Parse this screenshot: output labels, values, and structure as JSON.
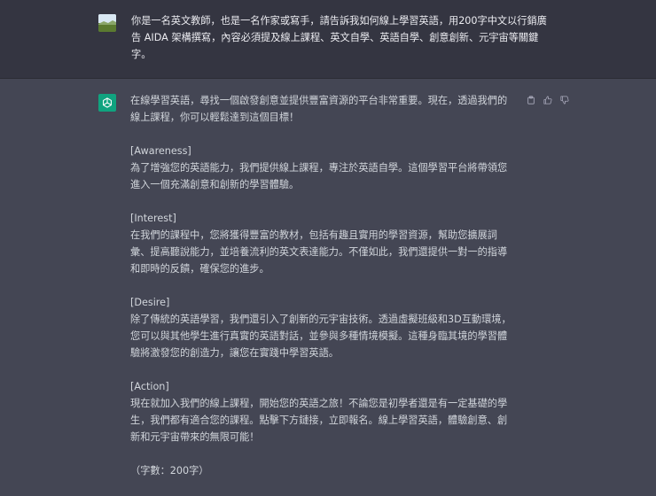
{
  "user_message": {
    "text": "你是一名英文教師，也是一名作家或寫手，請告訴我如何線上學習英語，用200字中文以行銷廣告 AIDA 架構撰寫，內容必須提及線上課程、英文自學、英語自學、創意創新、元宇宙等關鍵字。"
  },
  "assistant_message": {
    "intro": "在線學習英語，尋找一個啟發創意並提供豐富資源的平台非常重要。現在，透過我們的線上課程，你可以輕鬆達到這個目標！",
    "sections": [
      {
        "heading": "[Awareness]",
        "body": "為了增強您的英語能力，我們提供線上課程，專注於英語自學。這個學習平台將帶領您進入一個充滿創意和創新的學習體驗。"
      },
      {
        "heading": "[Interest]",
        "body": "在我們的課程中，您將獲得豐富的教材，包括有趣且實用的學習資源，幫助您擴展詞彙、提高聽說能力，並培養流利的英文表達能力。不僅如此，我們還提供一對一的指導和即時的反饋，確保您的進步。"
      },
      {
        "heading": "[Desire]",
        "body": "除了傳統的英語學習，我們還引入了創新的元宇宙技術。透過虛擬班級和3D互動環境，您可以與其他學生進行真實的英語對話，並參與多種情境模擬。這種身臨其境的學習體驗將激發您的創造力，讓您在實踐中學習英語。"
      },
      {
        "heading": "[Action]",
        "body": "現在就加入我們的線上課程，開始您的英語之旅！不論您是初學者還是有一定基礎的學生，我們都有適合您的課程。點擊下方鏈接，立即報名。線上學習英語，體驗創意、創新和元宇宙帶來的無限可能！"
      }
    ],
    "word_count": "（字數：200字）"
  },
  "icons": {
    "copy": "clipboard-icon",
    "thumbs_up": "thumbs-up-icon",
    "thumbs_down": "thumbs-down-icon",
    "assistant_logo": "openai-logo-icon",
    "user_avatar": "user-avatar-image"
  },
  "colors": {
    "user_bg": "#343541",
    "assistant_bg": "#444654",
    "logo_bg": "#10a37f"
  }
}
